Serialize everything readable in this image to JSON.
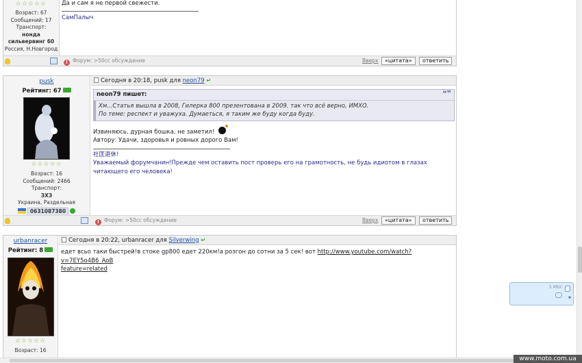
{
  "post1": {
    "user_info": [
      "Возраст: 67",
      "Сообщений: 17",
      "Транспорт:",
      "нонда сильвервинг 60",
      "Россия, Н.Новгород"
    ],
    "text_top": "Да и сам я не первой свежести.",
    "signature": "СамПалыч",
    "forum_label": "Форум: >50сс обсуждение",
    "up_link": "Вверх",
    "quote_button": "«цитата»",
    "reply_button": "ответить"
  },
  "post2": {
    "username": "pusk",
    "rating": "Рейтинг: 67",
    "date_prefix": "Сегодня в 20:18, pusk для",
    "reply_to": "neon79",
    "quote_author": "neon79 пишет:",
    "quote_line1": "Хм...Статья вышла в 2008, Гилерка 800 презентована в 2009. так что всё верно, ИМХО.",
    "quote_line2": "По теме: респект и уважуха. Думаеться, я таким же буду когда буду.",
    "text_line1": "Извиняюсь, дурная бошка, не заметил!",
    "text_line2": "Автору: Удачи, здоровья и  ровных дорого Вам!",
    "sig_title": "社匡退休!",
    "sig_text": "Уважаемый форумчанин!Прежде чем оставить пост проверь его на грамотность, не будь идиотом в глазах читающего его человека!",
    "user_info": [
      "Возраст: 16",
      "Сообщений: 2466",
      "Транспорт:"
    ],
    "transport_name": "ЗХЗ",
    "location": "Украина, Раздельная",
    "phone": "0631087380",
    "forum_label": "Форум: >50сс обсуждение",
    "up_link": "Вверх",
    "quote_button": "«цитата»",
    "reply_button": "ответить"
  },
  "post3": {
    "username": "urbanracer",
    "rating": "Рейтинг: 8",
    "date_prefix": "Сегодня в 20:22, urbanracer для",
    "reply_to": "Silverwing",
    "text": "едет всьо таки быстрей!в стоке gp800 едет 220км!а розгон до сотни за 5 сек! вот",
    "link_part1": "http://www.youtube.com/watch?v=7EY5o4B6_AoB",
    "link_part2": "feature=related",
    "user_info": [
      "Возраст: 16"
    ]
  },
  "chat_widget": {
    "size_label": "5 Кб/с"
  },
  "watermark": "www.moto.com.ua",
  "colors": {
    "accent_link": "#1f4e9e",
    "online_green": "#3aa830",
    "stars_green": "#7fae2e"
  }
}
